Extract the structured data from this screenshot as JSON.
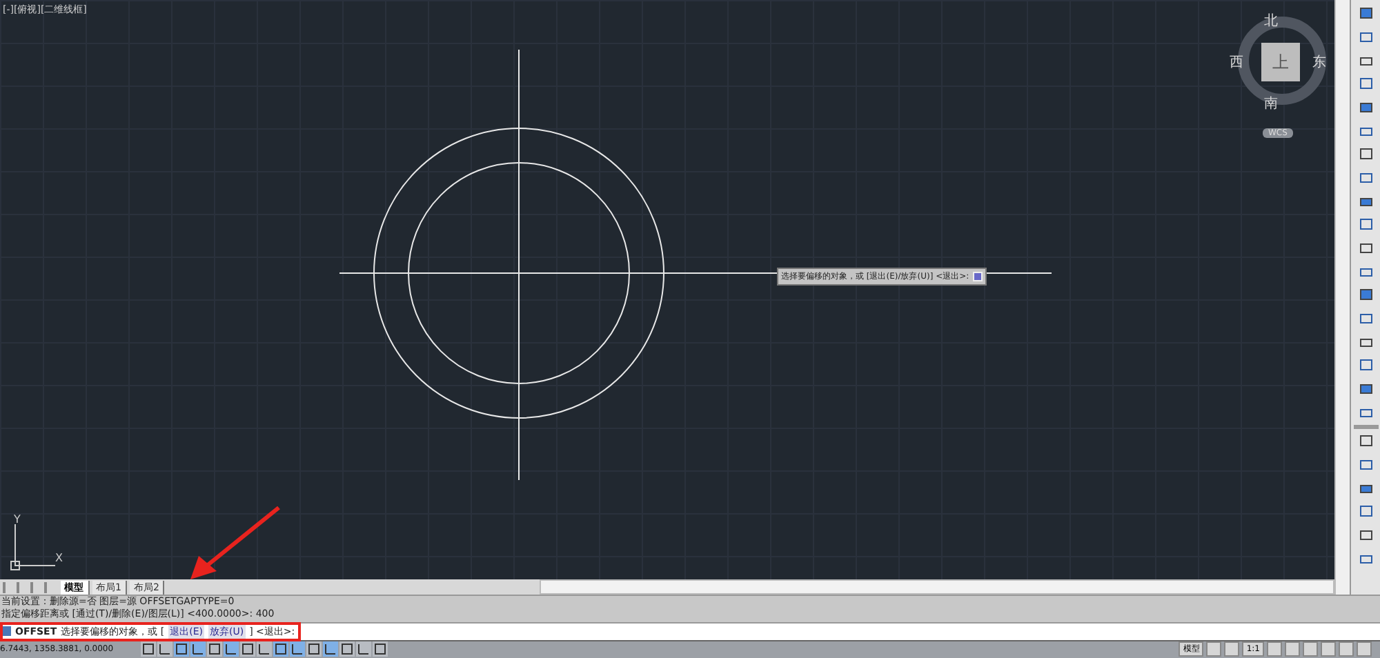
{
  "viewport_label": "[-][俯视][二维线框]",
  "viewcube": {
    "north": "北",
    "south": "南",
    "east": "东",
    "west": "西",
    "face": "上",
    "coordinate_system": "WCS"
  },
  "tooltip": "选择要偏移的对象，或 [退出(E)/放弃(U)] <退出>:",
  "ucs": {
    "x": "X",
    "y": "Y"
  },
  "layout_tabs": [
    {
      "label": "模型",
      "selected": true
    },
    {
      "label": "布局1",
      "selected": false
    },
    {
      "label": "布局2",
      "selected": false
    }
  ],
  "command_history": [
    "当前设置：删除源=否   图层=源   OFFSETGAPTYPE=0",
    "指定偏移距离或 [通过(T)/删除(E)/图层(L)] <400.0000>: 400"
  ],
  "command_line": {
    "command": "OFFSET",
    "prompt": "选择要偏移的对象，或 [",
    "options": [
      "退出(E)",
      "放弃(U)"
    ],
    "suffix": "] <退出>:"
  },
  "status_bar": {
    "coordinates": "6.7443, 1358.3881, 0.0000",
    "space": "模型",
    "scale": "1:1"
  },
  "status_toggles": [
    {
      "on": false
    },
    {
      "on": false
    },
    {
      "on": true
    },
    {
      "on": true
    },
    {
      "on": false
    },
    {
      "on": true
    },
    {
      "on": false
    },
    {
      "on": false
    },
    {
      "on": true
    },
    {
      "on": true
    },
    {
      "on": false
    },
    {
      "on": true
    },
    {
      "on": false
    },
    {
      "on": false
    },
    {
      "on": false
    }
  ]
}
